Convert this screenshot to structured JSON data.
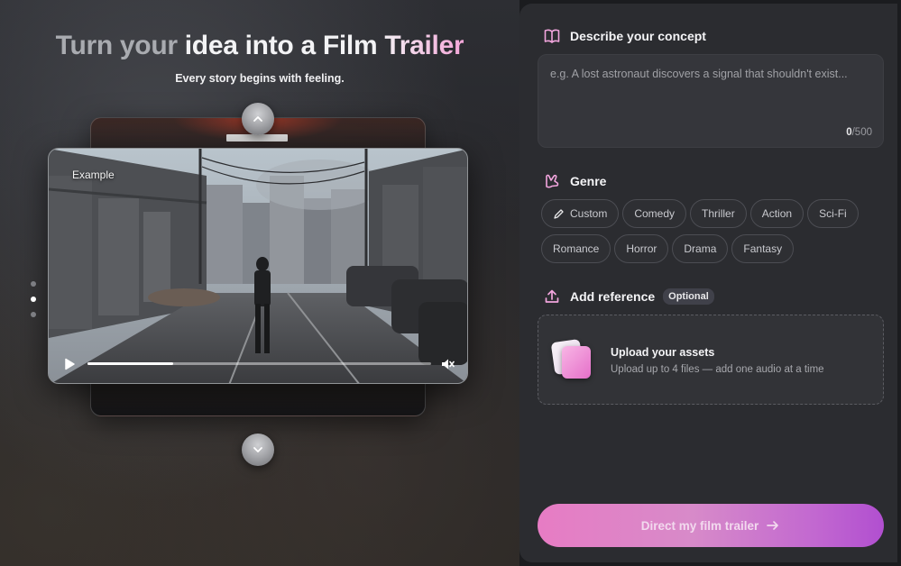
{
  "headline": {
    "part1": "Turn your ",
    "part2": "idea into a ",
    "part3": "Film Trailer",
    "subtitle": "Every story begins with feeling."
  },
  "player": {
    "tag": "Example",
    "progress": 0.25
  },
  "carousel": {
    "dots": 3,
    "active_index": 1
  },
  "concept": {
    "title": "Describe your concept",
    "placeholder": "e.g. A lost astronaut discovers a signal that shouldn't exist...",
    "count_current": "0",
    "count_max": "/500"
  },
  "genre": {
    "title": "Genre",
    "chips_row1": [
      "Custom",
      "Comedy",
      "Thriller",
      "Action",
      "Sci-Fi"
    ],
    "chips_row2": [
      "Romance",
      "Horror",
      "Drama",
      "Fantasy"
    ]
  },
  "reference": {
    "title": "Add reference",
    "badge": "Optional",
    "upload_title": "Upload your assets",
    "upload_subtitle": "Upload up to 4 files — add one audio at a time"
  },
  "cta": {
    "label": "Direct my film trailer"
  },
  "colors": {
    "accent_pink": "#e77cc4",
    "accent_purple": "#b14fd0",
    "panel": "#2b2c30"
  }
}
